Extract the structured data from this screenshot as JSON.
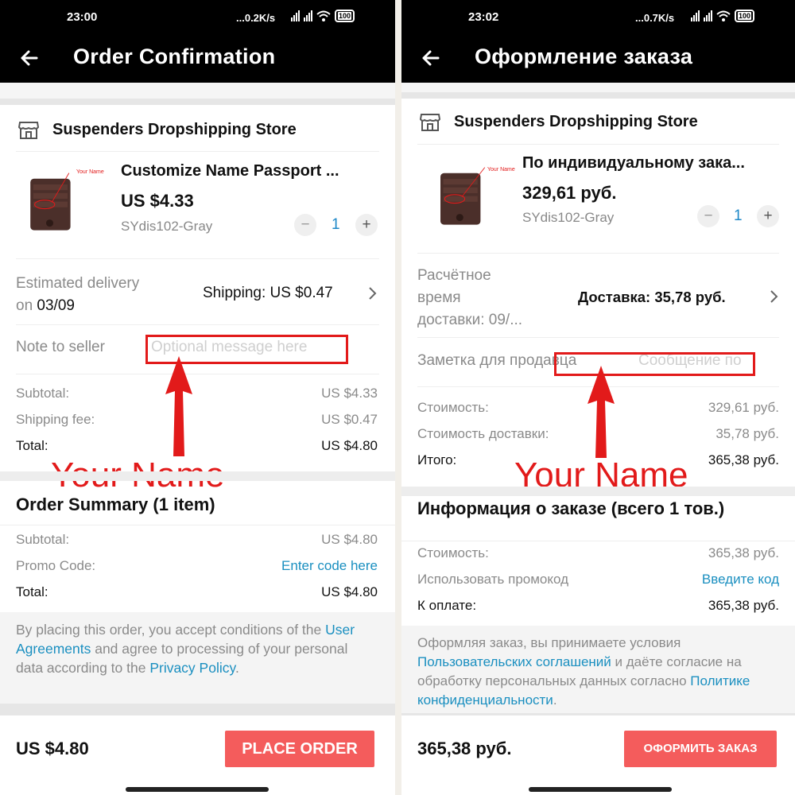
{
  "left": {
    "status": {
      "time": "23:00",
      "net": "...0.2K/s",
      "battery": "100"
    },
    "appbar": {
      "title": "Order Confirmation"
    },
    "store": {
      "name": "Suspenders Dropshipping Store"
    },
    "product": {
      "title": "Customize Name Passport ...",
      "price": "US $4.33",
      "sku": "SYdis102-Gray",
      "qty": "1",
      "thumb_label": "Your Name"
    },
    "delivery": {
      "line1": "Estimated delivery",
      "line2_prefix": "on ",
      "date": "03/09",
      "shipping": "Shipping: US $0.47"
    },
    "note": {
      "label": "Note to seller",
      "placeholder": "Optional message here"
    },
    "costs": [
      {
        "label": "Subtotal:",
        "value": "US $4.33"
      },
      {
        "label": "Shipping fee:",
        "value": "US $0.47"
      },
      {
        "label": "Total:",
        "value": "US $4.80"
      }
    ],
    "annotation": "Your Name",
    "summary": {
      "title": "Order Summary (1 item)",
      "rows": [
        {
          "label": "Subtotal:",
          "value": "US $4.80"
        },
        {
          "label": "Promo Code:",
          "value": "Enter code here"
        },
        {
          "label": "Total:",
          "value": "US $4.80"
        }
      ]
    },
    "legal": {
      "t1": "By placing this order, you accept conditions of the ",
      "link1": "User Agreements",
      "t2": " and agree to processing of your personal data according to the ",
      "link2": "Privacy Policy",
      "t3": "."
    },
    "footer": {
      "total": "US $4.80",
      "button": "PLACE ORDER"
    }
  },
  "right": {
    "status": {
      "time": "23:02",
      "net": "...0.7K/s",
      "battery": "100"
    },
    "appbar": {
      "title": "Оформление заказа"
    },
    "store": {
      "name": "Suspenders Dropshipping Store"
    },
    "product": {
      "title": "По индивидуальному зака...",
      "price": "329,61 руб.",
      "sku": "SYdis102-Gray",
      "qty": "1",
      "thumb_label": "Your Name"
    },
    "delivery": {
      "line1": "Расчётное",
      "line2": "время",
      "line3": "доставки: 09/...",
      "shipping": "Доставка: 35,78 руб."
    },
    "note": {
      "label": "Заметка для продавца",
      "placeholder": "Сообщение по"
    },
    "costs": [
      {
        "label": "Стоимость:",
        "value": "329,61 руб."
      },
      {
        "label": "Стоимость доставки:",
        "value": "35,78 руб."
      },
      {
        "label": "Итого:",
        "value": "365,38 руб."
      }
    ],
    "annotation": "Your Name",
    "summary": {
      "title": "Информация о заказе (всего 1 тов.)",
      "rows": [
        {
          "label": "Стоимость:",
          "value": "365,38 руб."
        },
        {
          "label": "Использовать промокод",
          "value": "Введите код"
        },
        {
          "label": "К оплате:",
          "value": "365,38 руб."
        }
      ]
    },
    "legal": {
      "t1": "Оформляя заказ, вы принимаете условия ",
      "link1": "Пользовательских соглашений",
      "t2": " и даёте согласие на обработку персональных данных согласно ",
      "link2": "Политике конфиденциальности",
      "t3": "."
    },
    "footer": {
      "total": "365,38 руб.",
      "button": "ОФОРМИТЬ ЗАКАЗ"
    }
  },
  "colors": {
    "accent_button": "#f45c5c",
    "link": "#1a8fc0",
    "annotation": "#e21a1a",
    "qty": "#1e88c8"
  }
}
